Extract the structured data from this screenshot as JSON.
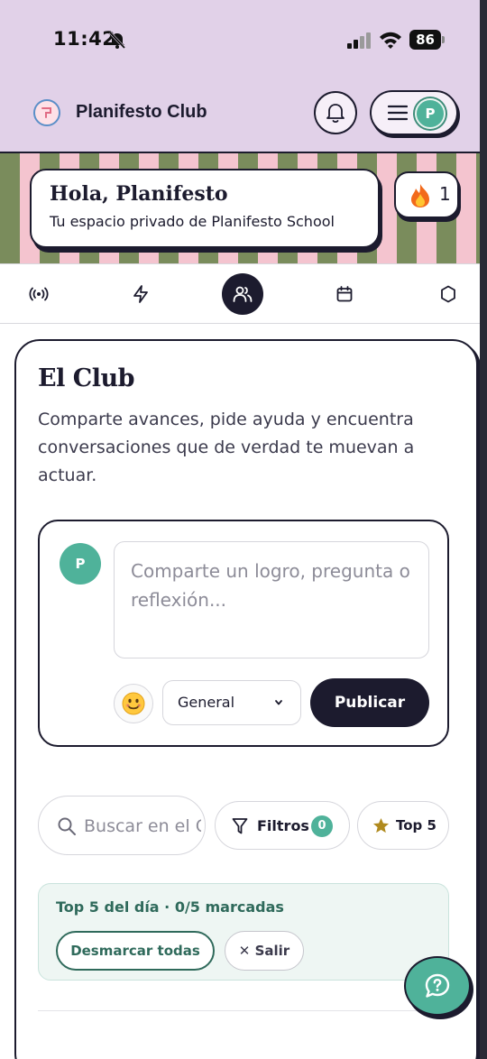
{
  "status_bar": {
    "time": "11:42",
    "battery": "86"
  },
  "header": {
    "app_title": "Planifesto Club",
    "avatar_initial": "P"
  },
  "banner": {
    "greeting": "Hola, Planifesto",
    "subtitle": "Tu espacio privado de Planifesto School",
    "streak_count": "1"
  },
  "tabs": [
    {
      "icon": "broadcast-icon"
    },
    {
      "icon": "lightning-icon"
    },
    {
      "icon": "users-icon",
      "active": true
    },
    {
      "icon": "calendar-icon"
    },
    {
      "icon": "hexagon-icon"
    }
  ],
  "club": {
    "title": "El Club",
    "description": "Comparte avances, pide ayuda y encuentra conversaciones que de verdad te muevan a actuar."
  },
  "composer": {
    "avatar_initial": "P",
    "placeholder": "Comparte un logro, pregunta o reflexión...",
    "category": "General",
    "publish_label": "Publicar"
  },
  "filters": {
    "search_placeholder": "Buscar en el Club",
    "filters_label": "Filtros",
    "filters_count": "0",
    "top5_label": "Top 5"
  },
  "top5_panel": {
    "title": "Top 5 del día · 0/5 marcadas",
    "unmark_label": "Desmarcar todas",
    "exit_label": "✕ Salir"
  },
  "colors": {
    "header_bg": "#e1d1e8",
    "primary_dark": "#1c1b2e",
    "accent_green": "#4fb29a",
    "stripe_green": "#7a8c5c",
    "stripe_pink": "#f4c4cf"
  }
}
